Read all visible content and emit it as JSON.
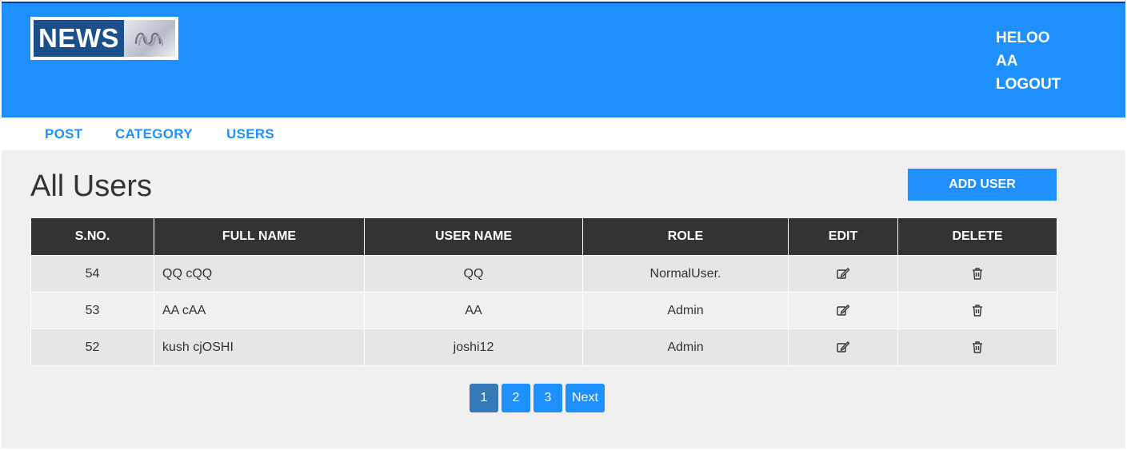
{
  "brand": {
    "logo_text": "NEWS",
    "logo_mark_icon": "abc-ribbon-logo-icon"
  },
  "user_menu": {
    "greeting": "HELOO",
    "username": "AA",
    "logout": "LOGOUT"
  },
  "nav": [
    {
      "label": "POST"
    },
    {
      "label": "CATEGORY"
    },
    {
      "label": "USERS"
    }
  ],
  "page": {
    "title": "All Users",
    "add_button": "ADD USER"
  },
  "table": {
    "headers": [
      "S.NO.",
      "FULL NAME",
      "USER NAME",
      "ROLE",
      "EDIT",
      "DELETE"
    ],
    "rows": [
      {
        "sno": "54",
        "full_name": "QQ cQQ",
        "user_name": "QQ",
        "role": "NormalUser."
      },
      {
        "sno": "53",
        "full_name": "AA cAA",
        "user_name": "AA",
        "role": "Admin"
      },
      {
        "sno": "52",
        "full_name": "kush cjOSHI",
        "user_name": "joshi12",
        "role": "Admin"
      }
    ],
    "edit_icon": "edit-icon",
    "delete_icon": "trash-icon"
  },
  "pagination": {
    "pages": [
      "1",
      "2",
      "3"
    ],
    "current": "1",
    "next_label": "Next"
  },
  "colors": {
    "primary": "#1e90ff",
    "header_dark": "#333333",
    "active_page": "#337ab7",
    "page_bg": "#f0f0f0",
    "logo_bg": "#1b4f8c"
  }
}
